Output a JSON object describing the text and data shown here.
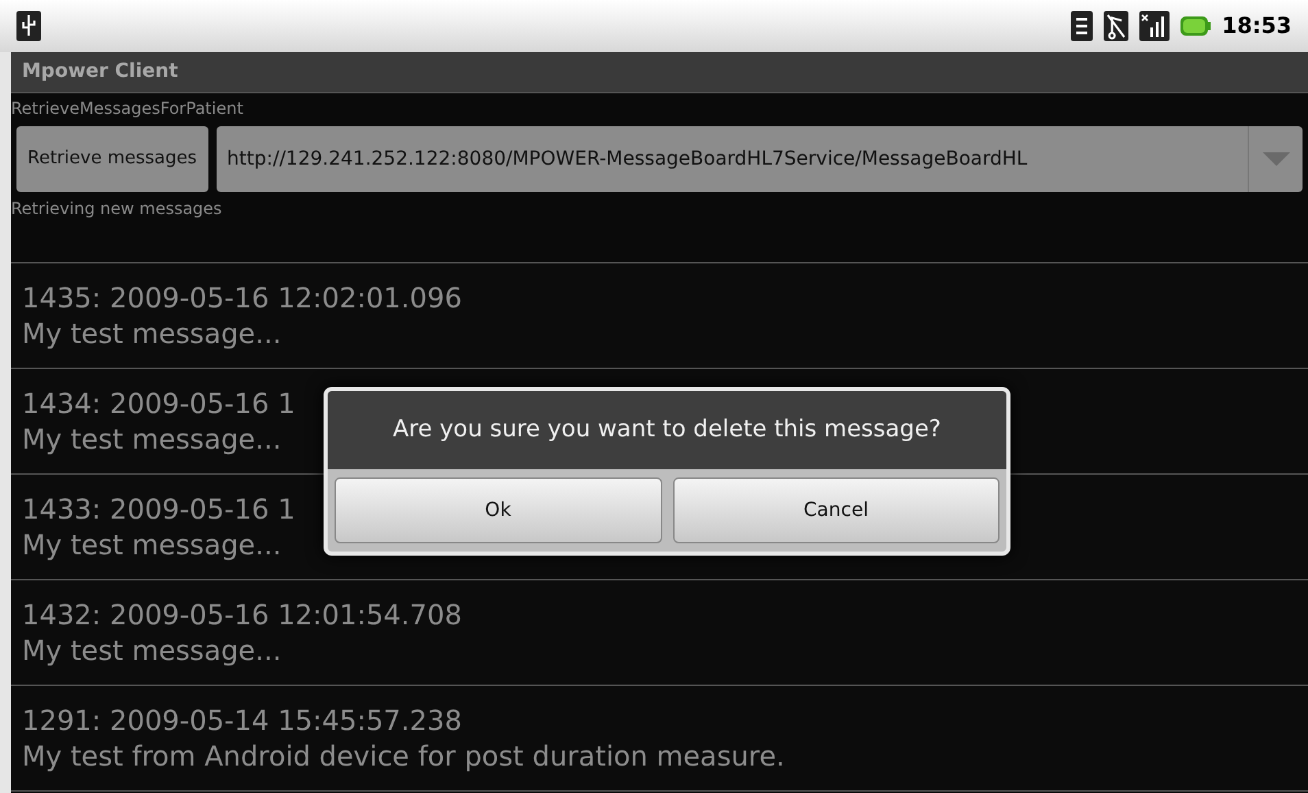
{
  "status_bar": {
    "time": "18:53"
  },
  "window": {
    "title": "Mpower Client"
  },
  "section_label": "RetrieveMessagesForPatient",
  "retrieve_button": "Retrieve messages",
  "url_field": {
    "value": "http://129.241.252.122:8080/MPOWER-MessageBoardHL7Service/MessageBoardHL"
  },
  "status_text": "Retrieving new messages",
  "messages": [
    {
      "header": "1435: 2009-05-16 12:02:01.096",
      "body": "My test message..."
    },
    {
      "header": "1434: 2009-05-16 1",
      "body": "My test message..."
    },
    {
      "header": "1433: 2009-05-16 1",
      "body": "My test message..."
    },
    {
      "header": "1432: 2009-05-16 12:01:54.708",
      "body": "My test message..."
    },
    {
      "header": "1291: 2009-05-14 15:45:57.238",
      "body": "My test from Android device for post duration measure."
    }
  ],
  "dialog": {
    "message": "Are you sure you want to delete this message?",
    "buttons": [
      "Ok",
      "Cancel"
    ]
  }
}
